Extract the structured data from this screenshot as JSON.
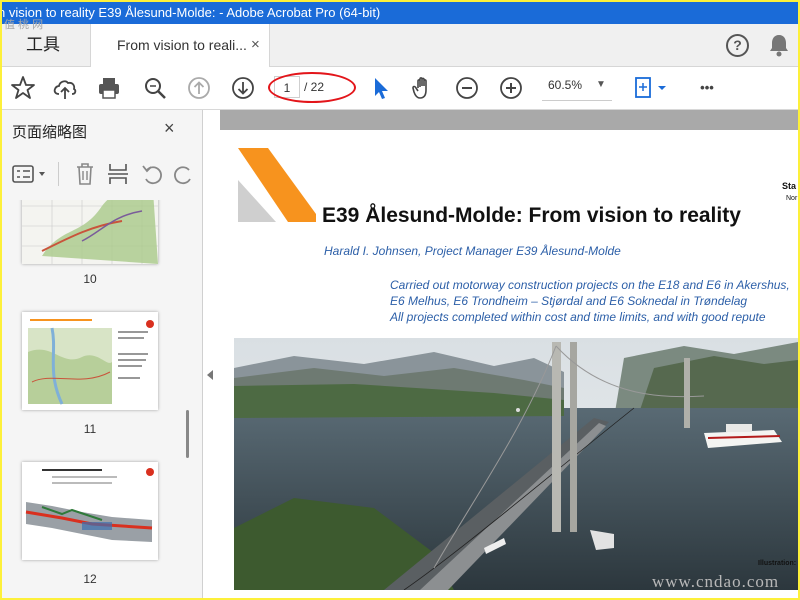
{
  "window": {
    "title": "n vision to reality E39 Ålesund-Molde:  - Adobe Acrobat Pro (64-bit)"
  },
  "tabs": {
    "tools_label": "工具",
    "document_label": "From vision to reali...",
    "close_symbol": "×"
  },
  "toolbar": {
    "current_page": "1",
    "total_pages": "/ 22",
    "zoom": "60.5%",
    "more": "•••"
  },
  "sidebar": {
    "title": "页面缩略图",
    "close_symbol": "×",
    "thumbnails": [
      {
        "label": "10"
      },
      {
        "label": "11"
      },
      {
        "label": "12"
      }
    ]
  },
  "document": {
    "title": "E39 Ålesund-Molde: From vision to reality",
    "author": "Harald I. Johnsen, Project Manager E39 Ålesund-Molde",
    "lines": [
      "Carried out motorway construction projects on the E18 and E6 in Akershus,",
      "E6 Melhus, E6 Trondheim – Stjørdal and E6 Soknedal in Trøndelag",
      "All projects completed within cost and time limits, and with good repute"
    ],
    "status_label": "Sta",
    "status_sub": "Nor",
    "illustration_label": "Illustration:"
  },
  "watermark": {
    "text": "www.cndao.com",
    "corner": "值 桃 网"
  },
  "colors": {
    "accent_blue": "#1a6bd8",
    "annotation_red": "#e3151a",
    "logo_orange": "#f7931e",
    "logo_gray": "#cfcfcf"
  }
}
